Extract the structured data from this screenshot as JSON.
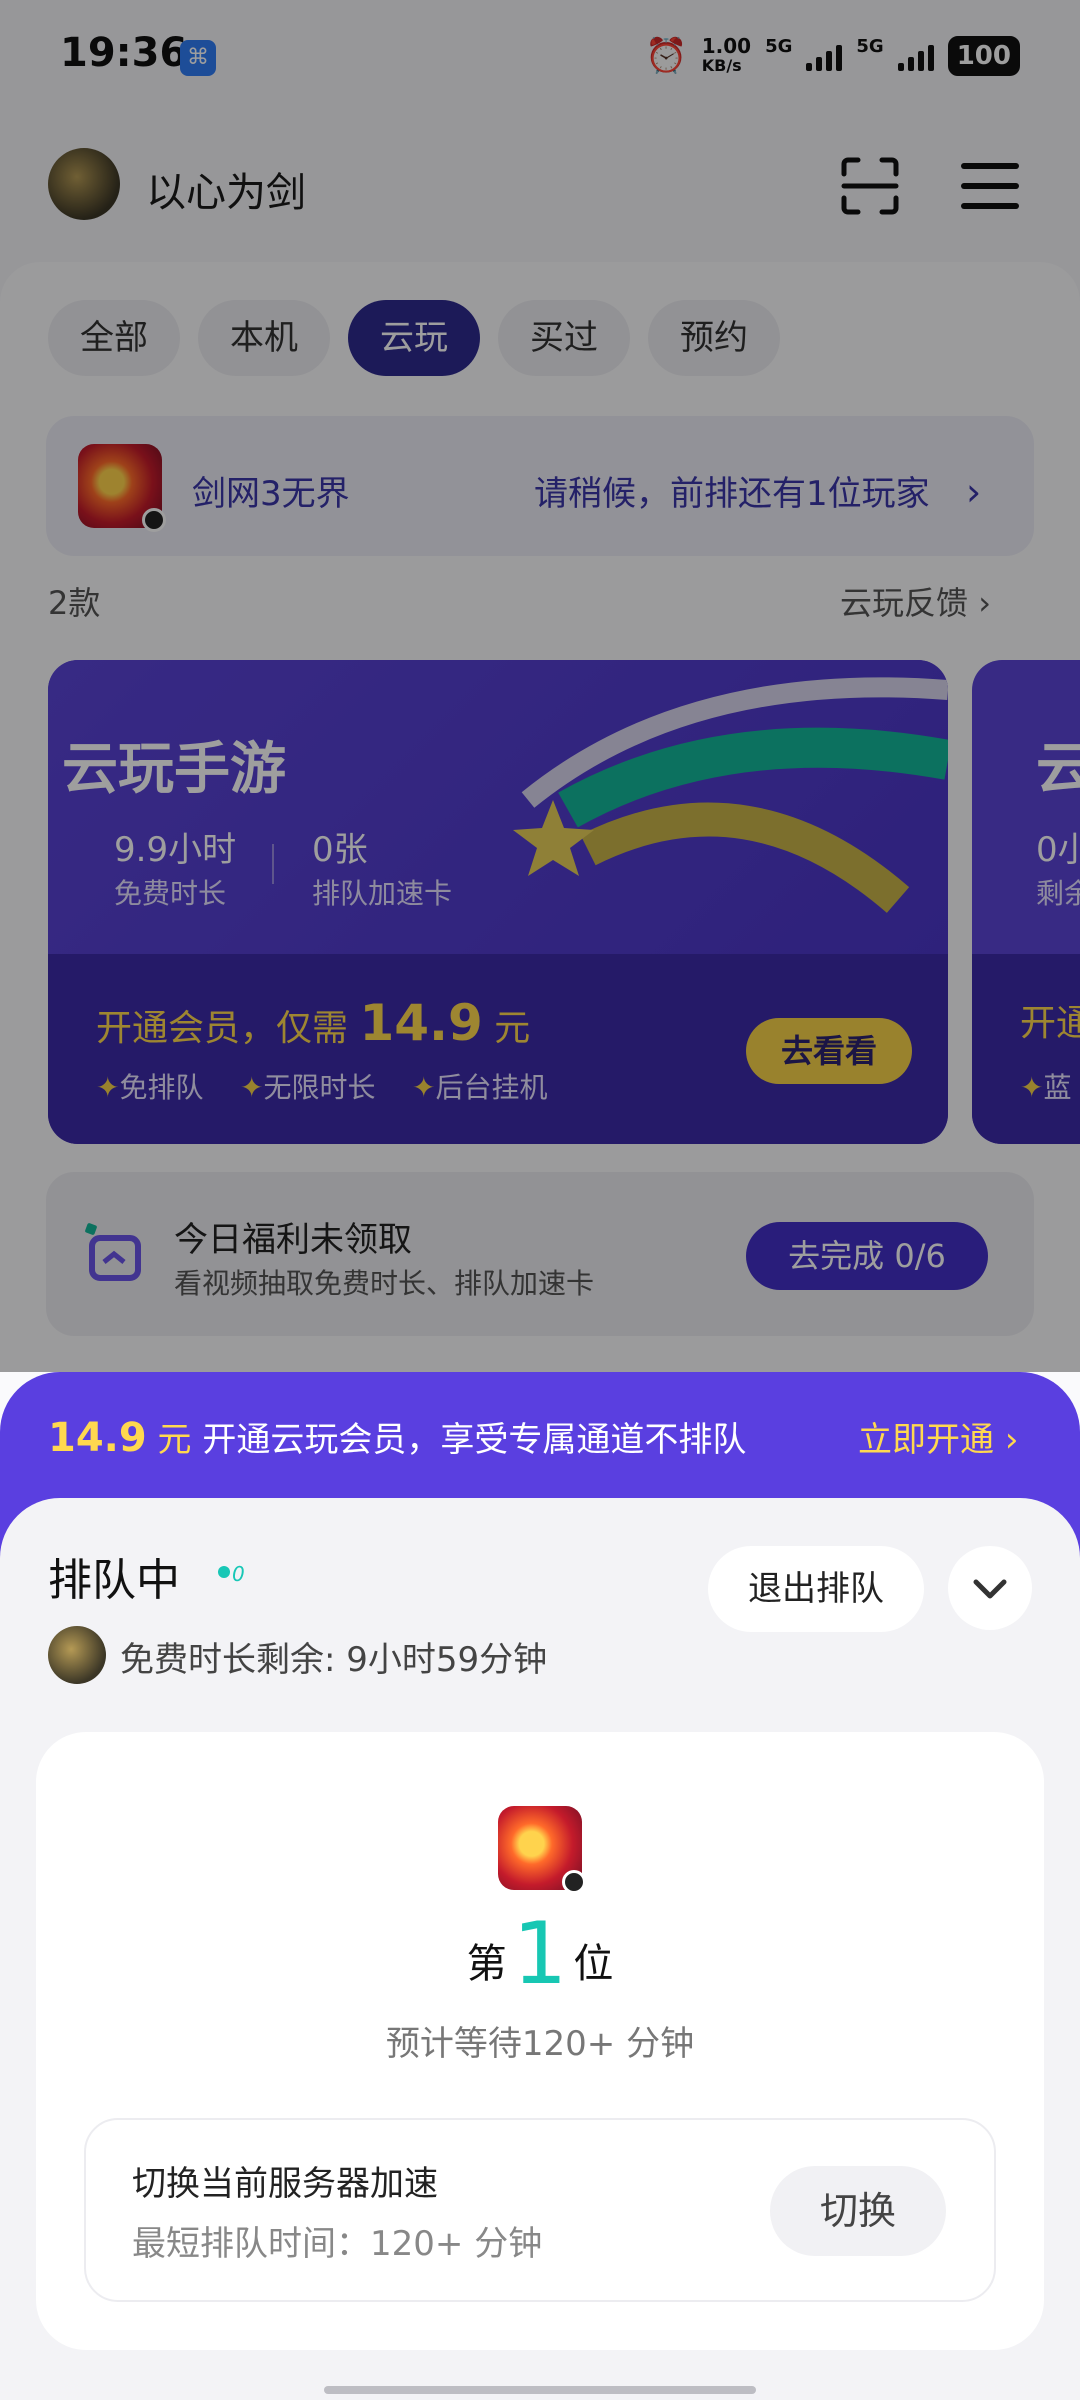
{
  "status_bar": {
    "time": "19:36",
    "net_speed": "1.00",
    "net_unit": "KB/s",
    "sim1": "5G",
    "sim2": "5G",
    "battery": "100"
  },
  "header": {
    "username": "以心为剑"
  },
  "tabs": [
    {
      "label": "全部"
    },
    {
      "label": "本机"
    },
    {
      "label": "云玩"
    },
    {
      "label": "买过"
    },
    {
      "label": "预约"
    }
  ],
  "active_tab": "云玩",
  "queue_banner": {
    "game_name": "剑网3无界",
    "status": "请稍候，前排还有1位玩家"
  },
  "list_meta": {
    "count": "2款",
    "feedback": "云玩反馈"
  },
  "promo_card": {
    "title": "云玩手游",
    "stat1_value": "9.9小时",
    "stat1_label": "免费时长",
    "stat2_value": "0张",
    "stat2_label": "排队加速卡",
    "offer_prefix": "开通会员，仅需",
    "offer_price": "14.9",
    "offer_unit": "元",
    "perks": [
      "免排队",
      "无限时长",
      "后台挂机"
    ],
    "button": "去看看"
  },
  "card2": {
    "title": "云",
    "stat": "0小",
    "label": "剩余",
    "offer": "开通",
    "perk": "蓝"
  },
  "welfare": {
    "title": "今日福利未领取",
    "subtitle": "看视频抽取免费时长、排队加速卡",
    "button": "去完成 0/6"
  },
  "sheet_promo": {
    "price": "14.9",
    "unit": "元",
    "text": "开通云玩会员，享受专属通道不排队",
    "link": "立即开通"
  },
  "sheet": {
    "title": "排队中",
    "dot_count": "0",
    "quit": "退出排队",
    "free_time": "免费时长剩余: 9小时59分钟",
    "rank_prefix": "第",
    "rank_number": "1",
    "rank_suffix": "位",
    "eta": "预计等待120+ 分钟",
    "switch_title": "切换当前服务器加速",
    "switch_sub": "最短排队时间：120+ 分钟",
    "switch_button": "切换"
  }
}
